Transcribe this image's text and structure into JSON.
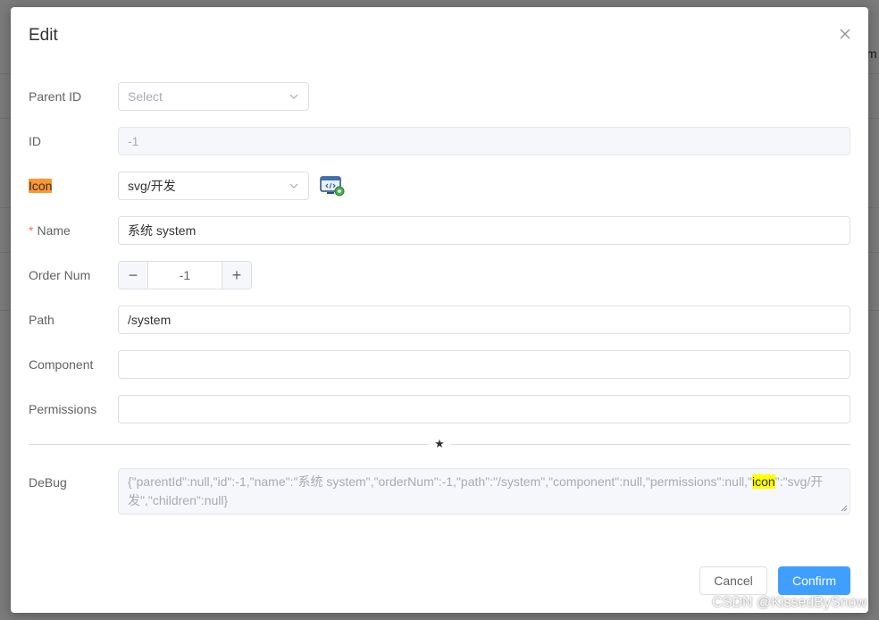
{
  "dialog": {
    "title": "Edit",
    "close_icon": "close-icon"
  },
  "background": {
    "fragment_text": "m"
  },
  "form": {
    "parent_id": {
      "label": "Parent ID",
      "placeholder": "Select",
      "value": ""
    },
    "id": {
      "label": "ID",
      "value": "-1",
      "disabled": true
    },
    "icon": {
      "label": "Icon",
      "value": "svg/开发",
      "preview_icon": "computer-settings-icon"
    },
    "name": {
      "label": "Name",
      "required_mark": "*",
      "value": "系统 system"
    },
    "order_num": {
      "label": "Order Num",
      "value": "-1",
      "minus": "−",
      "plus": "+"
    },
    "path": {
      "label": "Path",
      "value": "/system"
    },
    "component": {
      "label": "Component",
      "value": ""
    },
    "permissions": {
      "label": "Permissions",
      "value": ""
    },
    "divider_symbol": "★",
    "debug": {
      "label": "DeBug",
      "text_before": "{\"parentId\":null,\"id\":-1,\"name\":\"系统 system\",\"orderNum\":-1,\"path\":\"/system\",\"component\":null,\"permissions\":null,\"",
      "highlight": "icon",
      "text_after": "\":\"svg/开发\",\"children\":null}"
    }
  },
  "footer": {
    "cancel_label": "Cancel",
    "confirm_label": "Confirm"
  },
  "watermark": "CSDN @KissedBySnow",
  "colors": {
    "primary": "#409eff",
    "required": "#f56c6c",
    "label_highlight": "#ff9632",
    "text_highlight": "#ffff00"
  }
}
